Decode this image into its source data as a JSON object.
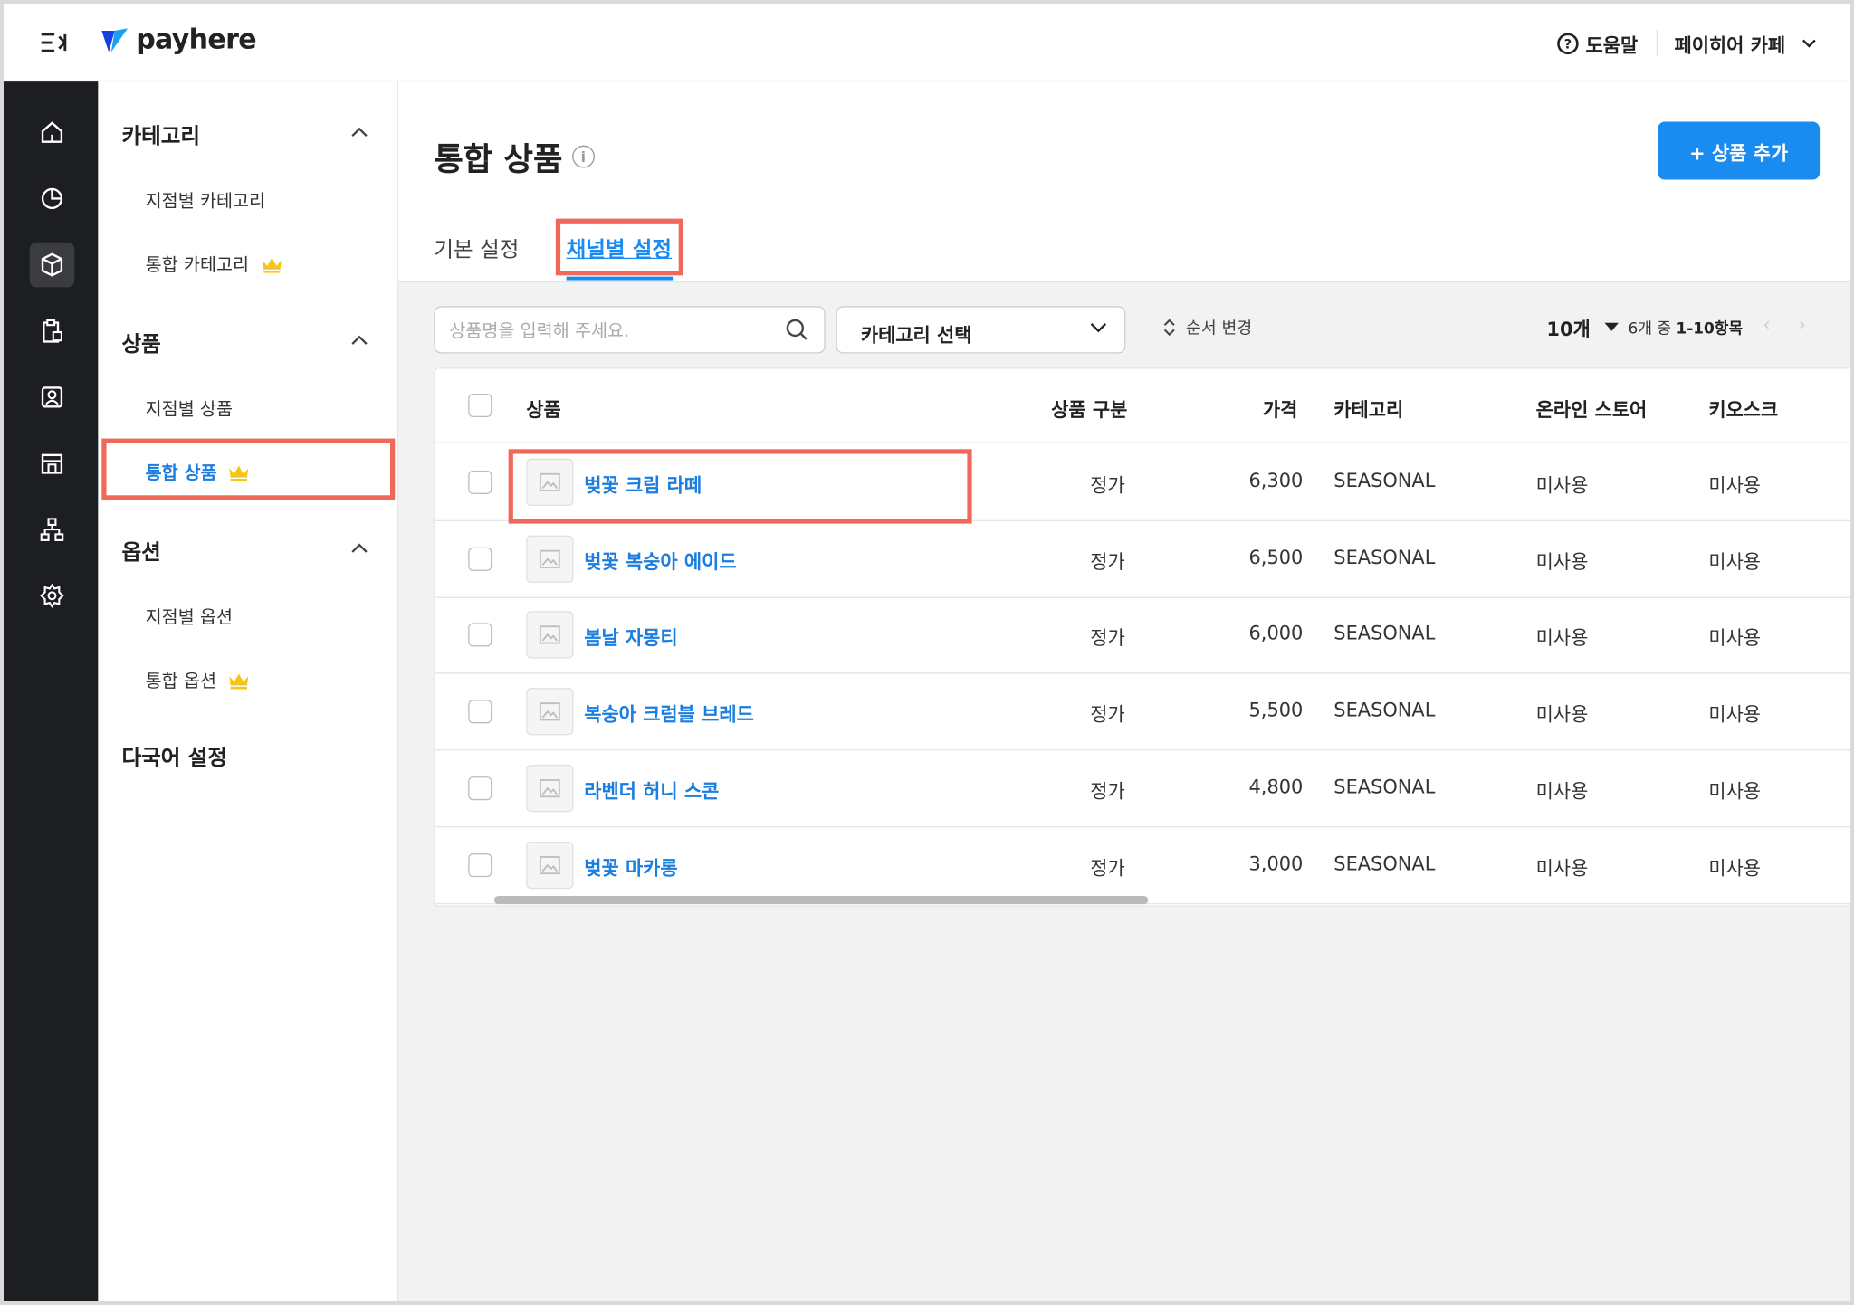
{
  "app": {
    "logo_text": "payhere"
  },
  "topbar": {
    "help_label": "도움말",
    "store_name": "페이히어 카페"
  },
  "rail": {
    "items": [
      {
        "icon": "home-icon"
      },
      {
        "icon": "chart-pie-icon"
      },
      {
        "icon": "box-icon"
      },
      {
        "icon": "clipboard-icon"
      },
      {
        "icon": "user-card-icon"
      },
      {
        "icon": "store-icon"
      },
      {
        "icon": "org-tree-icon"
      },
      {
        "icon": "gear-icon"
      }
    ],
    "active_index": 2
  },
  "sidebar": {
    "sections": [
      {
        "title": "카테고리",
        "items": [
          "지점별 카테고리",
          "통합 카테고리"
        ]
      },
      {
        "title": "상품",
        "items": [
          "지점별 상품",
          "통합 상품"
        ]
      },
      {
        "title": "옵션",
        "items": [
          "지점별 옵션",
          "통합 옵션"
        ]
      }
    ],
    "extra": "다국어 설정",
    "active_item": "통합 상품"
  },
  "page": {
    "title": "통합 상품",
    "add_button": "+ 상품 추가",
    "tabs": [
      "기본 설정",
      "채널별 설정"
    ],
    "active_tab": 1
  },
  "toolbar": {
    "search_placeholder": "상품명을 입력해 주세요.",
    "category_select": "카테고리 선택",
    "reorder_label": "순서 변경",
    "page_size": "10개",
    "range_prefix": "6개 중",
    "range_value": "1-10항목"
  },
  "table": {
    "columns": [
      "상품",
      "상품 구분",
      "가격",
      "카테고리",
      "온라인 스토어",
      "키오스크"
    ],
    "rows": [
      {
        "name": "벚꽃 크림 라떼",
        "type": "정가",
        "price": "6,300",
        "category": "SEASONAL",
        "online": "미사용",
        "kiosk": "미사용"
      },
      {
        "name": "벚꽃 복숭아 에이드",
        "type": "정가",
        "price": "6,500",
        "category": "SEASONAL",
        "online": "미사용",
        "kiosk": "미사용"
      },
      {
        "name": "봄날 자몽티",
        "type": "정가",
        "price": "6,000",
        "category": "SEASONAL",
        "online": "미사용",
        "kiosk": "미사용"
      },
      {
        "name": "복숭아 크럼블 브레드",
        "type": "정가",
        "price": "5,500",
        "category": "SEASONAL",
        "online": "미사용",
        "kiosk": "미사용"
      },
      {
        "name": "라벤더 허니 스콘",
        "type": "정가",
        "price": "4,800",
        "category": "SEASONAL",
        "online": "미사용",
        "kiosk": "미사용"
      },
      {
        "name": "벚꽃 마카롱",
        "type": "정가",
        "price": "3,000",
        "category": "SEASONAL",
        "online": "미사용",
        "kiosk": "미사용"
      }
    ]
  },
  "colors": {
    "accent": "#1a8cf0",
    "link": "#1a7de0",
    "highlight": "#f0685a",
    "rail_bg": "#1d1e22",
    "crown": "#f5c518"
  }
}
